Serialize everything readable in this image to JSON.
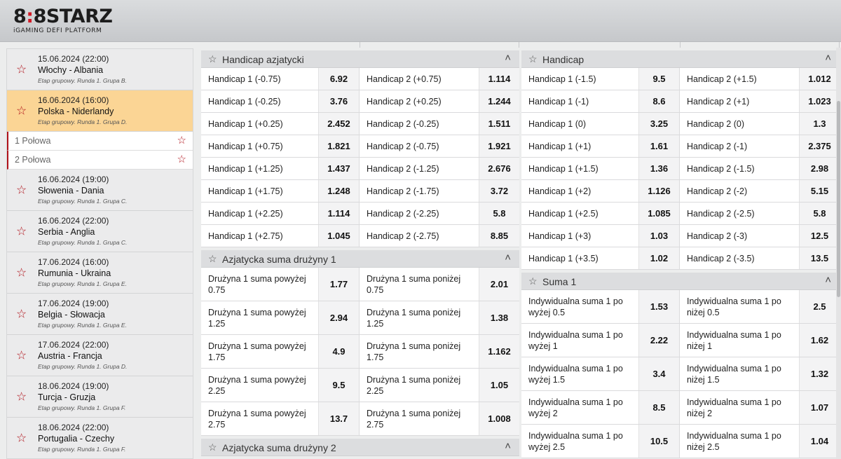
{
  "brand": {
    "logo_a": "8",
    "logo_b": "8",
    "logo_c": "STARZ",
    "logo_sep": ":",
    "tagline": "iGAMING DEFI PLATFORM"
  },
  "sidebar": {
    "matches": [
      {
        "date": "15.06.2024 (22:00)",
        "teams": "Włochy - Albania",
        "stage": "Etap grupowy. Runda 1. Grupa B."
      },
      {
        "date": "16.06.2024 (16:00)",
        "teams": "Polska - Niderlandy",
        "stage": "Etap grupowy. Runda 1. Grupa D."
      }
    ],
    "halves": [
      "1 Połowa",
      "2 Połowa"
    ],
    "matches_after": [
      {
        "date": "16.06.2024 (19:00)",
        "teams": "Słowenia - Dania",
        "stage": "Etap grupowy. Runda 1. Grupa C."
      },
      {
        "date": "16.06.2024 (22:00)",
        "teams": "Serbia - Anglia",
        "stage": "Etap grupowy. Runda 1. Grupa C."
      },
      {
        "date": "17.06.2024 (16:00)",
        "teams": "Rumunia - Ukraina",
        "stage": "Etap grupowy. Runda 1. Grupa E."
      },
      {
        "date": "17.06.2024 (19:00)",
        "teams": "Belgia - Słowacja",
        "stage": "Etap grupowy. Runda 1. Grupa E."
      },
      {
        "date": "17.06.2024 (22:00)",
        "teams": "Austria - Francja",
        "stage": "Etap grupowy. Runda 1. Grupa D."
      },
      {
        "date": "18.06.2024 (19:00)",
        "teams": "Turcja - Gruzja",
        "stage": "Etap grupowy. Runda 1. Grupa F."
      },
      {
        "date": "18.06.2024 (22:00)",
        "teams": "Portugalia - Czechy",
        "stage": "Etap grupowy. Runda 1. Grupa F."
      }
    ]
  },
  "icons": {
    "star": "star-icon",
    "chevron": "chevron-up-icon"
  },
  "colors": {
    "accent": "#b0121a",
    "active_row": "#fbd595",
    "logo_red": "#d21a26"
  },
  "col1": [
    {
      "title": "Handicap azjatycki",
      "tall": false,
      "rows": [
        [
          "Handicap 1 (-0.75)",
          "6.92",
          "Handicap 2 (+0.75)",
          "1.114"
        ],
        [
          "Handicap 1 (-0.25)",
          "3.76",
          "Handicap 2 (+0.25)",
          "1.244"
        ],
        [
          "Handicap 1 (+0.25)",
          "2.452",
          "Handicap 2 (-0.25)",
          "1.511"
        ],
        [
          "Handicap 1 (+0.75)",
          "1.821",
          "Handicap 2 (-0.75)",
          "1.921"
        ],
        [
          "Handicap 1 (+1.25)",
          "1.437",
          "Handicap 2 (-1.25)",
          "2.676"
        ],
        [
          "Handicap 1 (+1.75)",
          "1.248",
          "Handicap 2 (-1.75)",
          "3.72"
        ],
        [
          "Handicap 1 (+2.25)",
          "1.114",
          "Handicap 2 (-2.25)",
          "5.8"
        ],
        [
          "Handicap 1 (+2.75)",
          "1.045",
          "Handicap 2 (-2.75)",
          "8.85"
        ]
      ]
    },
    {
      "title": "Azjatycka suma drużyny 1",
      "tall": true,
      "rows": [
        [
          "Drużyna 1 suma powyżej 0.75",
          "1.77",
          "Drużyna 1 suma poniżej 0.75",
          "2.01"
        ],
        [
          "Drużyna 1 suma powyżej 1.25",
          "2.94",
          "Drużyna 1 suma poniżej 1.25",
          "1.38"
        ],
        [
          "Drużyna 1 suma powyżej 1.75",
          "4.9",
          "Drużyna 1 suma poniżej 1.75",
          "1.162"
        ],
        [
          "Drużyna 1 suma powyżej 2.25",
          "9.5",
          "Drużyna 1 suma poniżej 2.25",
          "1.05"
        ],
        [
          "Drużyna 1 suma powyżej 2.75",
          "13.7",
          "Drużyna 1 suma poniżej 2.75",
          "1.008"
        ]
      ]
    },
    {
      "title": "Azjatycka suma drużyny 2",
      "tall": true,
      "rows": []
    }
  ],
  "col2": [
    {
      "title": "Handicap",
      "tall": false,
      "rows": [
        [
          "Handicap 1 (-1.5)",
          "9.5",
          "Handicap 2 (+1.5)",
          "1.012"
        ],
        [
          "Handicap 1 (-1)",
          "8.6",
          "Handicap 2 (+1)",
          "1.023"
        ],
        [
          "Handicap 1 (0)",
          "3.25",
          "Handicap 2 (0)",
          "1.3"
        ],
        [
          "Handicap 1 (+1)",
          "1.61",
          "Handicap 2 (-1)",
          "2.375"
        ],
        [
          "Handicap 1 (+1.5)",
          "1.36",
          "Handicap 2 (-1.5)",
          "2.98"
        ],
        [
          "Handicap 1 (+2)",
          "1.126",
          "Handicap 2 (-2)",
          "5.15"
        ],
        [
          "Handicap 1 (+2.5)",
          "1.085",
          "Handicap 2 (-2.5)",
          "5.8"
        ],
        [
          "Handicap 1 (+3)",
          "1.03",
          "Handicap 2 (-3)",
          "12.5"
        ],
        [
          "Handicap 1 (+3.5)",
          "1.02",
          "Handicap 2 (-3.5)",
          "13.5"
        ]
      ]
    },
    {
      "title": "Suma 1",
      "tall": true,
      "rows": [
        [
          "Indywidualna suma 1 po wyżej 0.5",
          "1.53",
          "Indywidualna suma 1 po niżej 0.5",
          "2.5"
        ],
        [
          "Indywidualna suma 1 po wyżej 1",
          "2.22",
          "Indywidualna suma 1 po niżej 1",
          "1.62"
        ],
        [
          "Indywidualna suma 1 po wyżej 1.5",
          "3.4",
          "Indywidualna suma 1 po niżej 1.5",
          "1.32"
        ],
        [
          "Indywidualna suma 1 po wyżej 2",
          "8.5",
          "Indywidualna suma 1 po niżej 2",
          "1.07"
        ],
        [
          "Indywidualna suma 1 po wyżej 2.5",
          "10.5",
          "Indywidualna suma 1 po niżej 2.5",
          "1.04"
        ]
      ]
    }
  ]
}
